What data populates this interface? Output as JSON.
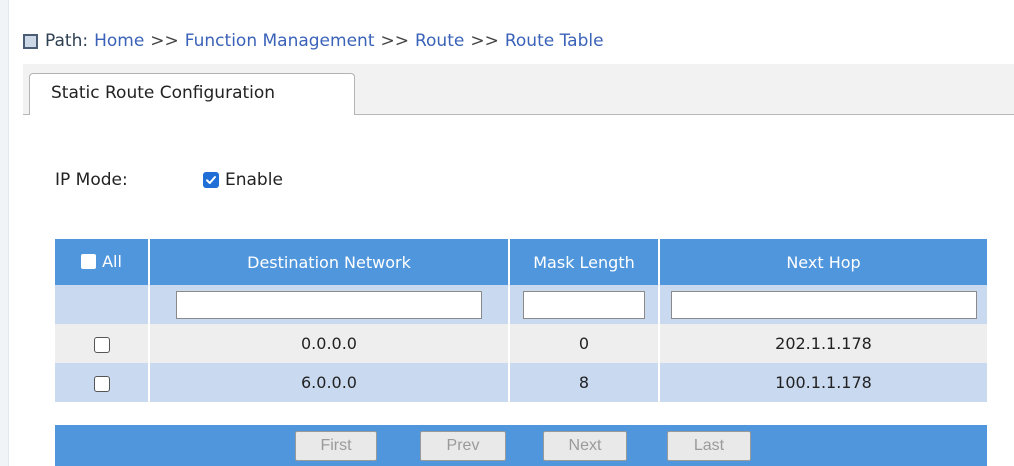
{
  "breadcrumb": {
    "label": "Path:",
    "items": [
      "Home",
      "Function Management",
      "Route",
      "Route Table"
    ],
    "separator": ">>"
  },
  "tabs": [
    {
      "label": "Static Route Configuration",
      "active": true
    }
  ],
  "ip_mode": {
    "label": "IP Mode:",
    "checkbox_label": "Enable",
    "checked": true
  },
  "table": {
    "headers": {
      "all": "All",
      "destination": "Destination Network",
      "mask": "Mask Length",
      "next_hop": "Next Hop"
    },
    "rows": [
      {
        "destination": "0.0.0.0",
        "mask": "0",
        "next_hop": "202.1.1.178",
        "checked": false
      },
      {
        "destination": "6.0.0.0",
        "mask": "8",
        "next_hop": "100.1.1.178",
        "checked": false
      }
    ]
  },
  "pager": {
    "first": "First",
    "prev": "Prev",
    "next": "Next",
    "last": "Last"
  },
  "colors": {
    "header_blue": "#4f96dc",
    "row_blue": "#c8d9f0",
    "row_gray": "#eeeeee",
    "link": "#3a62b8",
    "checkbox_accent": "#1f6fd6"
  }
}
